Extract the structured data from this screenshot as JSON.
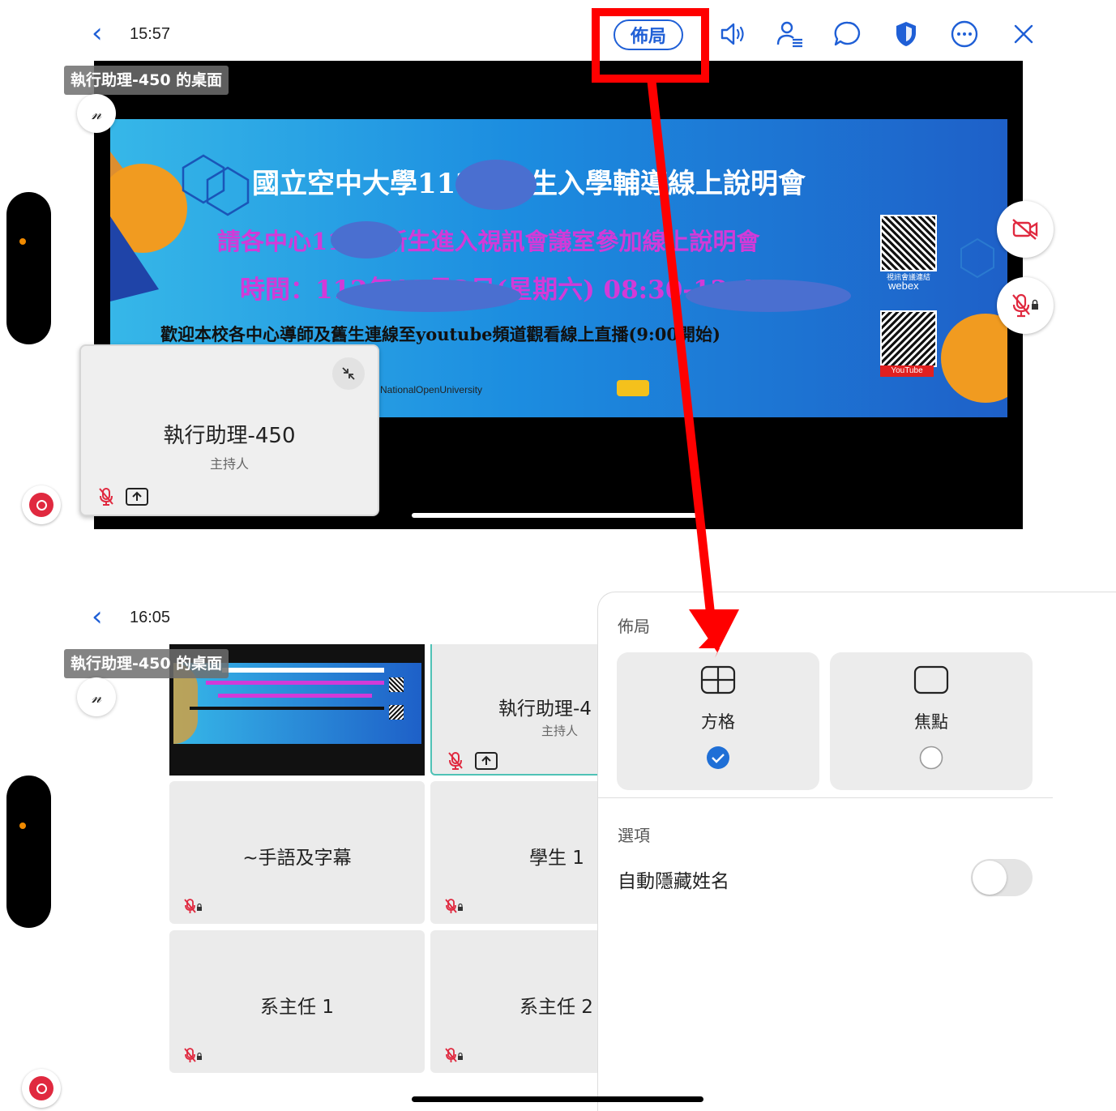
{
  "top": {
    "time": "15:57",
    "layout_button": "佈局",
    "share_label": "執行助理-450 的桌面",
    "banner": {
      "title": "國立空中大學112下新生入學輔導線上說明會",
      "line2": "請各中心112下新生進入視訊會議室參加線上說明會",
      "line3": "時間：112年12月2日(星期六) 08:30-12:40",
      "line4": "歡迎本校各中心導師及舊生連線至youtube頻道觀看線上直播(9:00開始)",
      "webex_caption": "視訊會議連結",
      "webex_brand": "webex",
      "youtube_brand": "YouTube",
      "nou_logo": "NationalOpenUniversity"
    },
    "self_tile": {
      "name": "執行助理-450",
      "role": "主持人"
    }
  },
  "bottom": {
    "time": "16:05",
    "share_label": "執行助理-450 的桌面",
    "host_tile": {
      "name": "執行助理-4",
      "role": "主持人"
    },
    "tiles": [
      {
        "name": "~手語及字幕"
      },
      {
        "name": "學生 1"
      },
      {
        "name": "系主任 1"
      },
      {
        "name": "系主任 2"
      }
    ],
    "panel": {
      "title": "佈局",
      "options": [
        {
          "label": "方格",
          "selected": true
        },
        {
          "label": "焦點",
          "selected": false
        }
      ],
      "section": "選項",
      "toggle_label": "自動隱藏姓名",
      "toggle_on": false
    }
  },
  "colors": {
    "accent": "#1f5fd6",
    "highlight": "#ff0000",
    "record": "#e0293f"
  }
}
